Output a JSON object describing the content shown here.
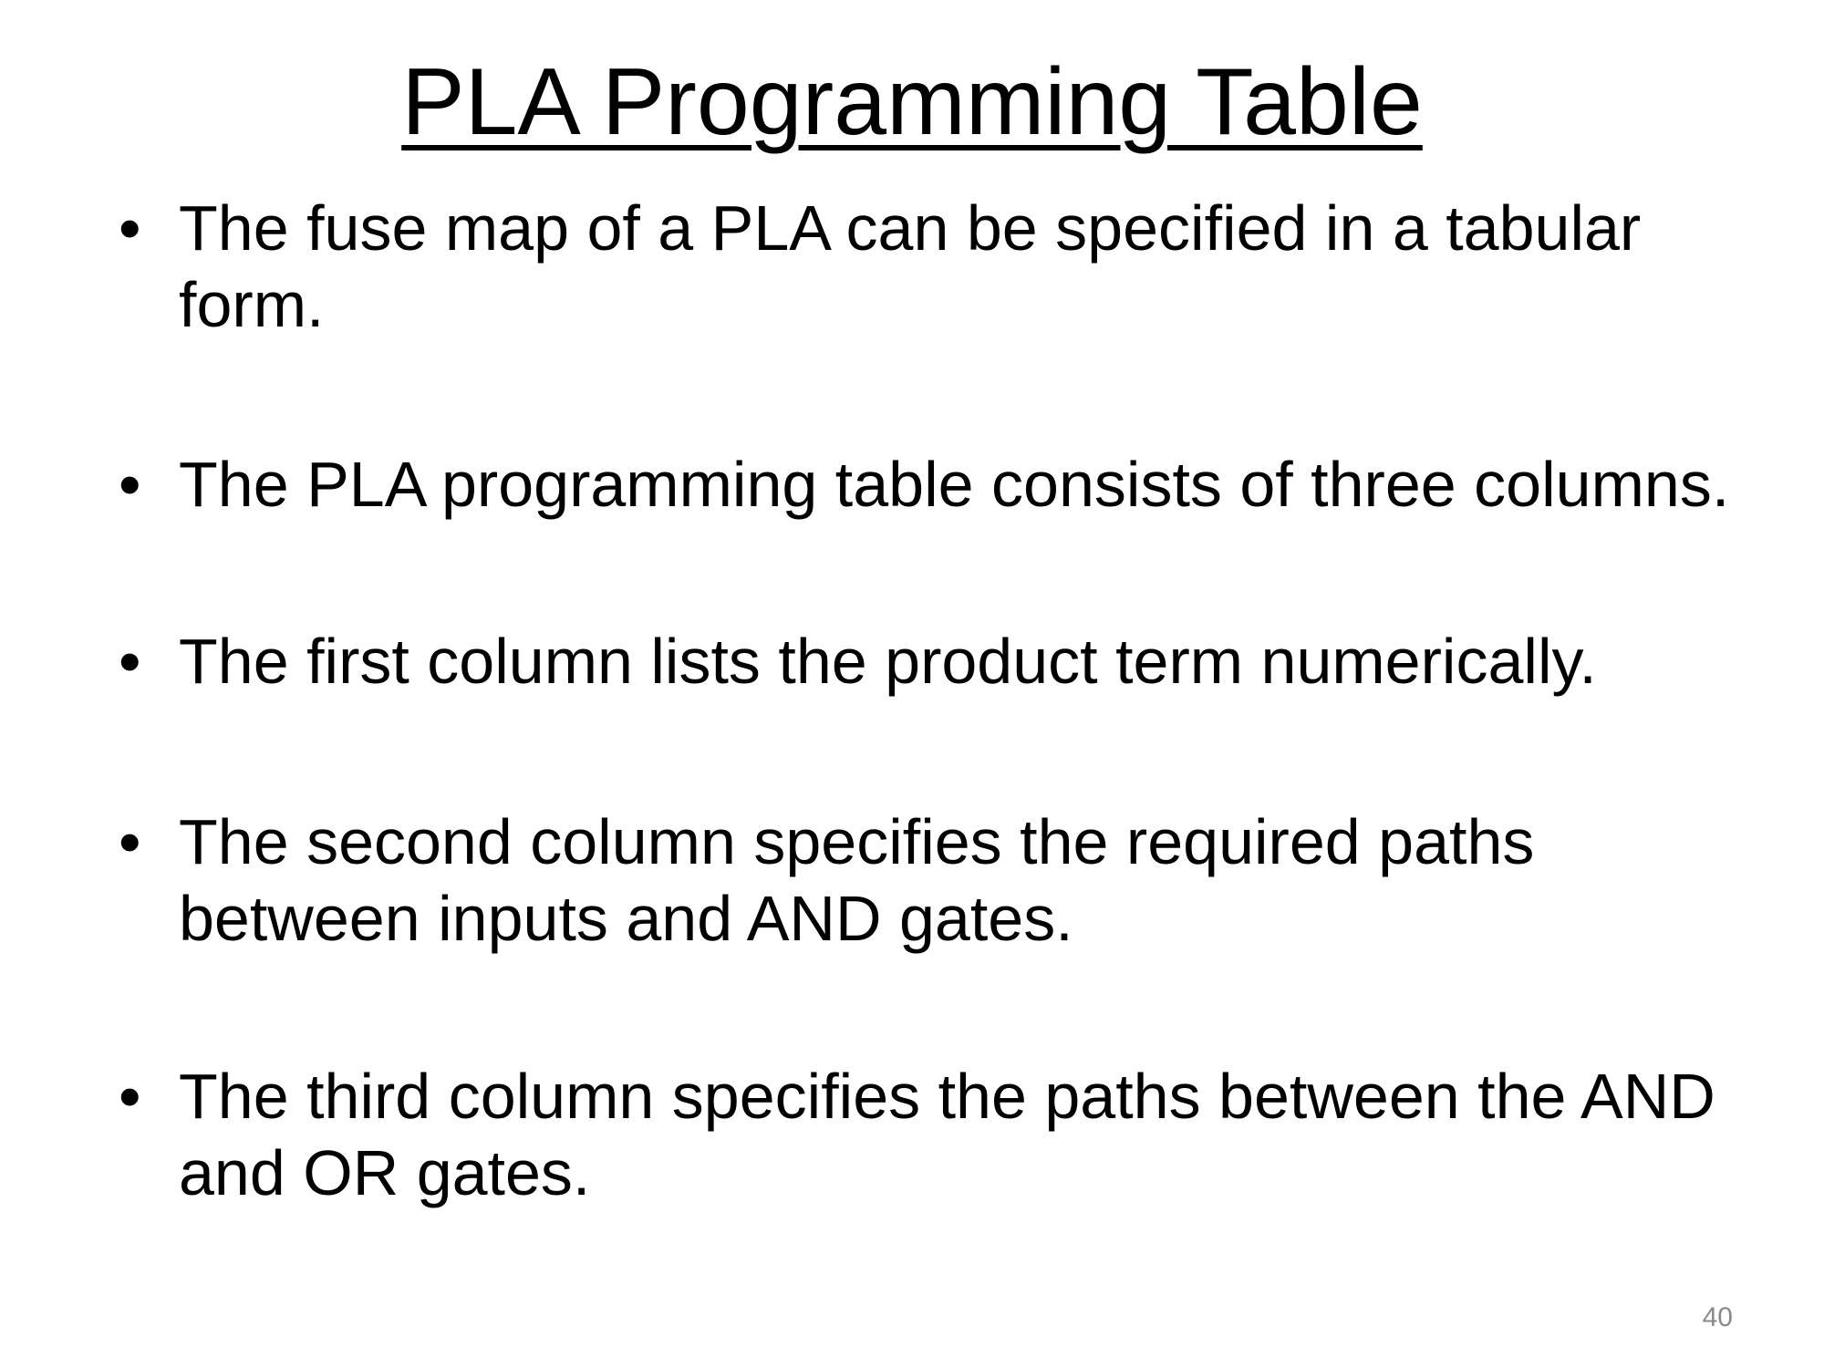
{
  "slide": {
    "title": "PLA Programming Table",
    "bullet_symbol": "•",
    "bullets": [
      "The fuse map of a PLA can be specified in a tabular form.",
      "The PLA programming table consists of three columns.",
      "The first column lists the product term numerically.",
      "The second column specifies the required paths between inputs and AND gates.",
      "The third column specifies the paths between the AND and OR gates."
    ],
    "page_number": "40"
  }
}
